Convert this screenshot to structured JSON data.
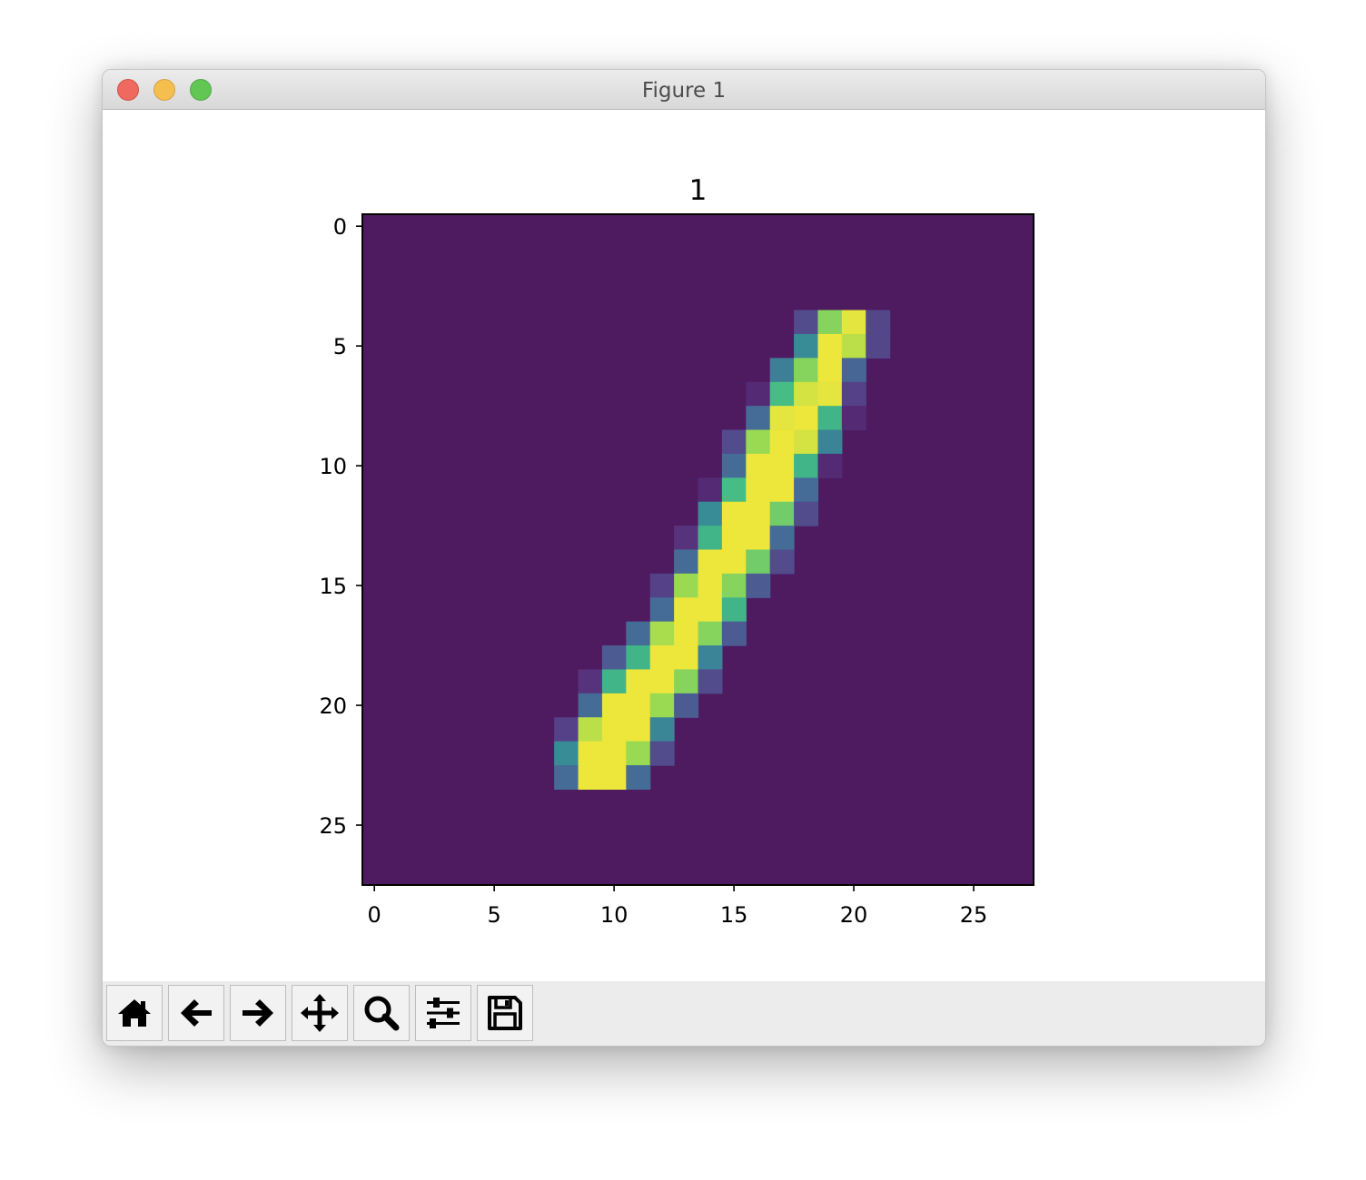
{
  "window": {
    "title": "Figure 1"
  },
  "toolbar": {
    "buttons": [
      {
        "name": "home-button",
        "icon": "home-icon"
      },
      {
        "name": "back-button",
        "icon": "arrow-left-icon"
      },
      {
        "name": "forward-button",
        "icon": "arrow-right-icon"
      },
      {
        "name": "pan-button",
        "icon": "move-icon"
      },
      {
        "name": "zoom-button",
        "icon": "magnifier-icon"
      },
      {
        "name": "configure-subplots-button",
        "icon": "sliders-icon"
      },
      {
        "name": "save-button",
        "icon": "floppy-disk-icon"
      }
    ]
  },
  "colors": {
    "background_cell": "#4e1a60",
    "colormap": "viridis",
    "traffic_close": "#ee6a5f",
    "traffic_minimize": "#f5bf4f",
    "traffic_maximize": "#62c655"
  },
  "chart_data": {
    "type": "heatmap",
    "title": "1",
    "xlabel": "",
    "ylabel": "",
    "xlim": [
      -0.5,
      27.5
    ],
    "ylim": [
      27.5,
      -0.5
    ],
    "xticks": [
      0,
      5,
      10,
      15,
      20,
      25
    ],
    "yticks": [
      0,
      5,
      10,
      15,
      20,
      25
    ],
    "colormap": "viridis",
    "value_range": [
      0,
      1
    ],
    "background_value": 0,
    "nonzero_cells": [
      {
        "row": 4,
        "cols": [
          18,
          19,
          20,
          21
        ],
        "values": [
          0.22,
          0.85,
          0.97,
          0.2
        ]
      },
      {
        "row": 5,
        "cols": [
          18,
          19,
          20,
          21
        ],
        "values": [
          0.55,
          0.98,
          0.92,
          0.2
        ]
      },
      {
        "row": 6,
        "cols": [
          17,
          18,
          19,
          20
        ],
        "values": [
          0.48,
          0.85,
          0.98,
          0.35
        ]
      },
      {
        "row": 7,
        "cols": [
          16,
          17,
          18,
          19,
          20
        ],
        "values": [
          0.08,
          0.75,
          0.95,
          0.97,
          0.18
        ]
      },
      {
        "row": 8,
        "cols": [
          16,
          17,
          18,
          19,
          20
        ],
        "values": [
          0.38,
          0.97,
          0.98,
          0.72,
          0.08
        ]
      },
      {
        "row": 9,
        "cols": [
          15,
          16,
          17,
          18,
          19
        ],
        "values": [
          0.22,
          0.88,
          0.98,
          0.95,
          0.5
        ]
      },
      {
        "row": 10,
        "cols": [
          15,
          16,
          17,
          18,
          19
        ],
        "values": [
          0.38,
          0.98,
          0.98,
          0.72,
          0.08
        ]
      },
      {
        "row": 11,
        "cols": [
          14,
          15,
          16,
          17,
          18
        ],
        "values": [
          0.08,
          0.75,
          0.98,
          0.98,
          0.38
        ]
      },
      {
        "row": 12,
        "cols": [
          14,
          15,
          16,
          17,
          18
        ],
        "values": [
          0.55,
          0.98,
          0.98,
          0.82,
          0.22
        ]
      },
      {
        "row": 13,
        "cols": [
          13,
          14,
          15,
          16,
          17
        ],
        "values": [
          0.12,
          0.72,
          0.98,
          0.98,
          0.38
        ]
      },
      {
        "row": 14,
        "cols": [
          13,
          14,
          15,
          16,
          17
        ],
        "values": [
          0.38,
          0.98,
          0.98,
          0.82,
          0.22
        ]
      },
      {
        "row": 15,
        "cols": [
          12,
          13,
          14,
          15,
          16
        ],
        "values": [
          0.18,
          0.88,
          0.98,
          0.85,
          0.3
        ]
      },
      {
        "row": 16,
        "cols": [
          12,
          13,
          14,
          15
        ],
        "values": [
          0.38,
          0.98,
          0.98,
          0.72
        ]
      },
      {
        "row": 17,
        "cols": [
          11,
          12,
          13,
          14,
          15
        ],
        "values": [
          0.38,
          0.9,
          0.98,
          0.85,
          0.3
        ]
      },
      {
        "row": 18,
        "cols": [
          10,
          11,
          12,
          13,
          14
        ],
        "values": [
          0.3,
          0.72,
          0.98,
          0.98,
          0.5
        ]
      },
      {
        "row": 19,
        "cols": [
          9,
          10,
          11,
          12,
          13,
          14
        ],
        "values": [
          0.12,
          0.72,
          0.98,
          0.98,
          0.85,
          0.22
        ]
      },
      {
        "row": 20,
        "cols": [
          9,
          10,
          11,
          12,
          13
        ],
        "values": [
          0.38,
          0.98,
          0.98,
          0.88,
          0.3
        ]
      },
      {
        "row": 21,
        "cols": [
          8,
          9,
          10,
          11,
          12
        ],
        "values": [
          0.18,
          0.92,
          0.98,
          0.98,
          0.52
        ]
      },
      {
        "row": 22,
        "cols": [
          8,
          9,
          10,
          11,
          12
        ],
        "values": [
          0.55,
          0.98,
          0.98,
          0.88,
          0.22
        ]
      },
      {
        "row": 23,
        "cols": [
          8,
          9,
          10,
          11
        ],
        "values": [
          0.38,
          0.98,
          0.98,
          0.38
        ]
      }
    ]
  }
}
